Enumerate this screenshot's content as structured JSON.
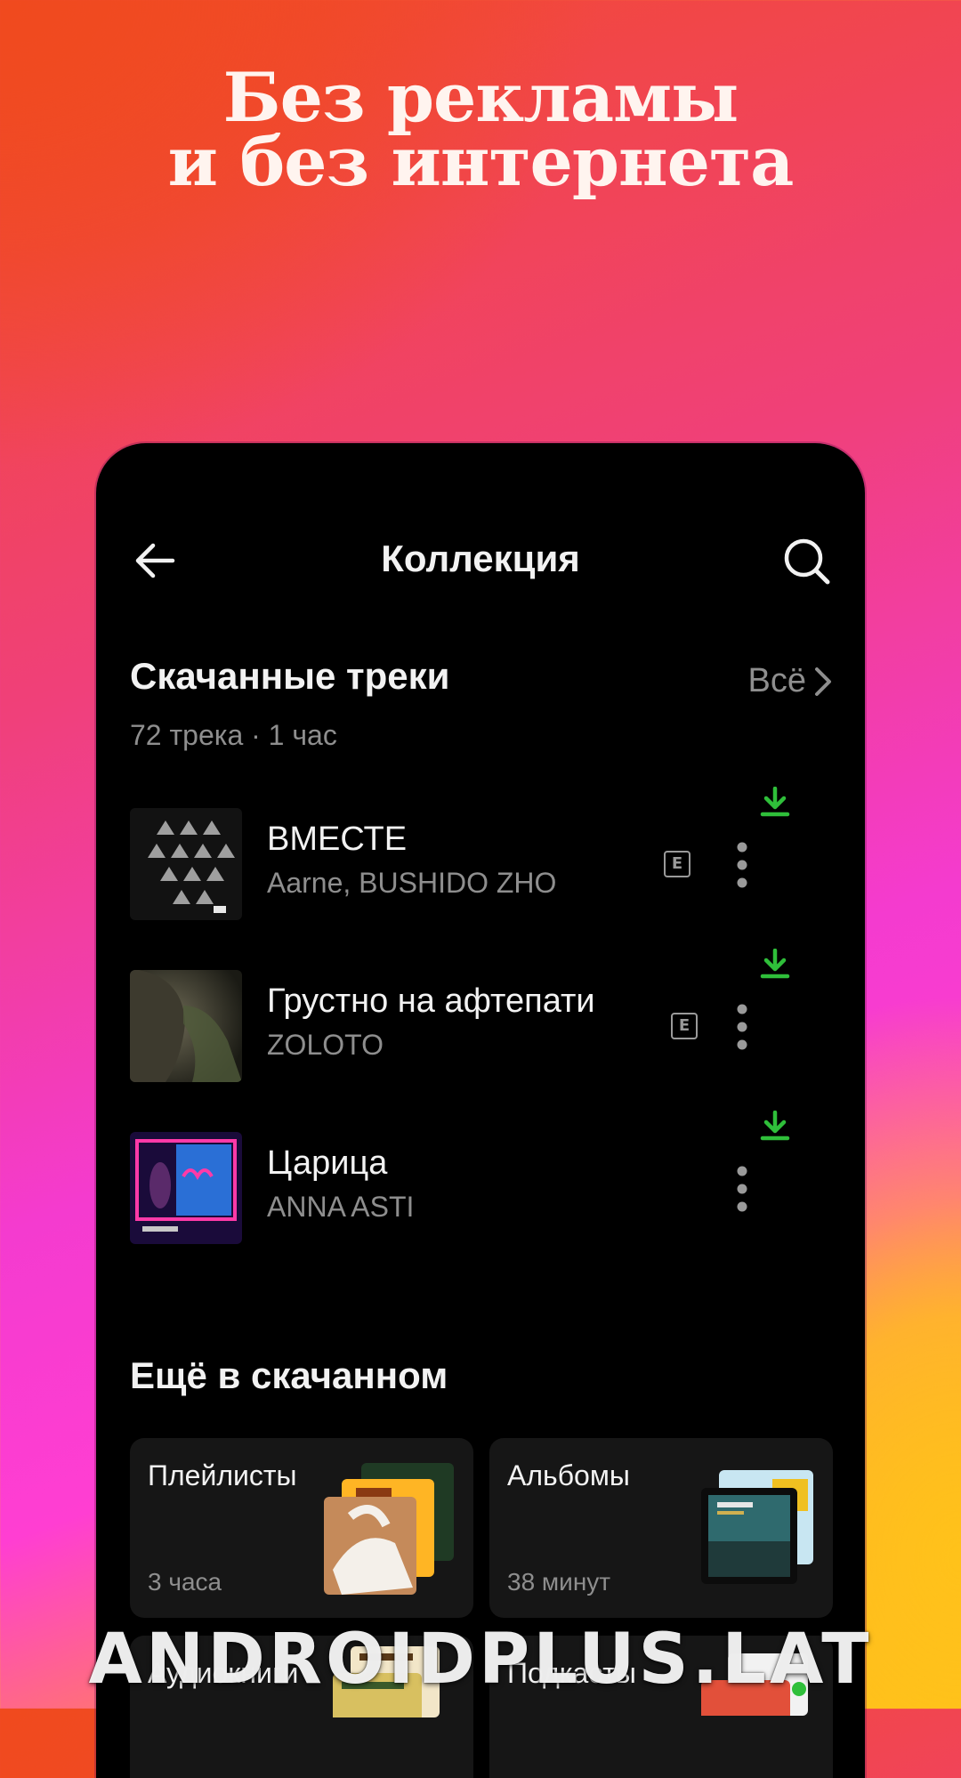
{
  "promo": {
    "headline_line1": "Без рекламы",
    "headline_line2": "и без интернета"
  },
  "header": {
    "title": "Коллекция",
    "back_icon": "arrow-left-icon",
    "search_icon": "search-icon"
  },
  "downloads": {
    "title": "Скачанные треки",
    "subtitle": "72 трека · 1 час",
    "see_all": "Всё",
    "tracks": [
      {
        "title": "ВМЕСТЕ",
        "artist": "Aarne, BUSHIDO ZHO",
        "explicit": "E",
        "downloaded": true
      },
      {
        "title": "Грустно на афтепати",
        "artist": "ZOLOTO",
        "explicit": "E",
        "downloaded": true
      },
      {
        "title": "Царица",
        "artist": "ANNA ASTI",
        "explicit": "",
        "downloaded": true
      }
    ]
  },
  "more": {
    "title": "Ещё в скачанном",
    "cards": [
      {
        "title": "Плейлисты",
        "subtitle": "3 часа"
      },
      {
        "title": "Альбомы",
        "subtitle": "38 минут"
      },
      {
        "title": "Аудиокниги",
        "subtitle": ""
      },
      {
        "title": "Подкасты",
        "subtitle": ""
      }
    ]
  },
  "colors": {
    "download_green": "#2fbf3a",
    "card_bg": "#161616",
    "accent_orange": "#f04a1e"
  },
  "watermark": "ANDROIDPLUS.LAT"
}
